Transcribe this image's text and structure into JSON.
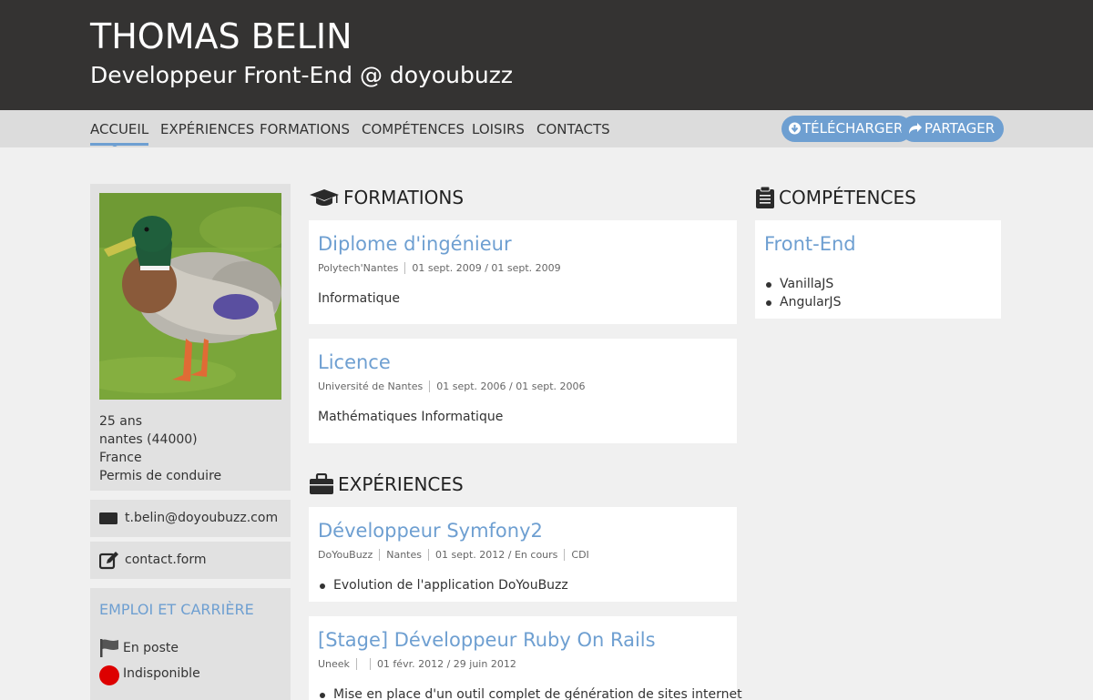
{
  "header": {
    "name": "THOMAS BELIN",
    "subtitle": "Developpeur Front-End @ doyoubuzz"
  },
  "nav": {
    "items": [
      "ACCUEIL",
      "EXPÉRIENCES",
      "FORMATIONS",
      "COMPÉTENCES",
      "LOISIRS",
      "CONTACTS"
    ],
    "download_label": "TÉLÉCHARGER",
    "share_label": "PARTAGER"
  },
  "colors": {
    "header_bg": "#343332",
    "accent": "#6e9fd1",
    "nav_bg": "#dcdcdc",
    "page_bg": "#f0f0f0",
    "unavailable": "#dd0000"
  },
  "profile": {
    "photo": "duck-photo",
    "age": "25 ans",
    "city": "nantes (44000)",
    "country": "France",
    "license": "Permis de conduire"
  },
  "contact": {
    "email": "t.belin@doyoubuzz.com",
    "form": "contact.form"
  },
  "career": {
    "title": "EMPLOI ET CARRIÈRE",
    "status": "En poste",
    "availability": "Indisponible"
  },
  "formations": {
    "title": "FORMATIONS",
    "icon": "graduation-cap-icon",
    "items": [
      {
        "title": "Diplome d'ingénieur",
        "school": "Polytech'Nantes",
        "dates": "01 sept. 2009 / 01 sept. 2009",
        "desc": "Informatique"
      },
      {
        "title": "Licence",
        "school": "Université de Nantes",
        "dates": "01 sept. 2006 / 01 sept. 2006",
        "desc": "Mathématiques Informatique"
      }
    ]
  },
  "experiences": {
    "title": "EXPÉRIENCES",
    "icon": "briefcase-icon",
    "items": [
      {
        "title": "Développeur Symfony2",
        "company": "DoYouBuzz",
        "location": "Nantes",
        "dates": "01 sept. 2012 / En cours",
        "contract": "CDI",
        "bullets": [
          "Evolution de l'application DoYouBuzz"
        ]
      },
      {
        "title": "[Stage] Développeur Ruby On Rails",
        "company": "Uneek",
        "location": "",
        "dates": "01 févr. 2012 / 29 juin 2012",
        "bullets": [
          "Mise en place d'un outil complet de génération de sites internet"
        ]
      }
    ]
  },
  "competences": {
    "title": "COMPÉTENCES",
    "icon": "clipboard-icon",
    "group": {
      "title": "Front-End",
      "items": [
        "VanillaJS",
        "AngularJS"
      ]
    }
  }
}
